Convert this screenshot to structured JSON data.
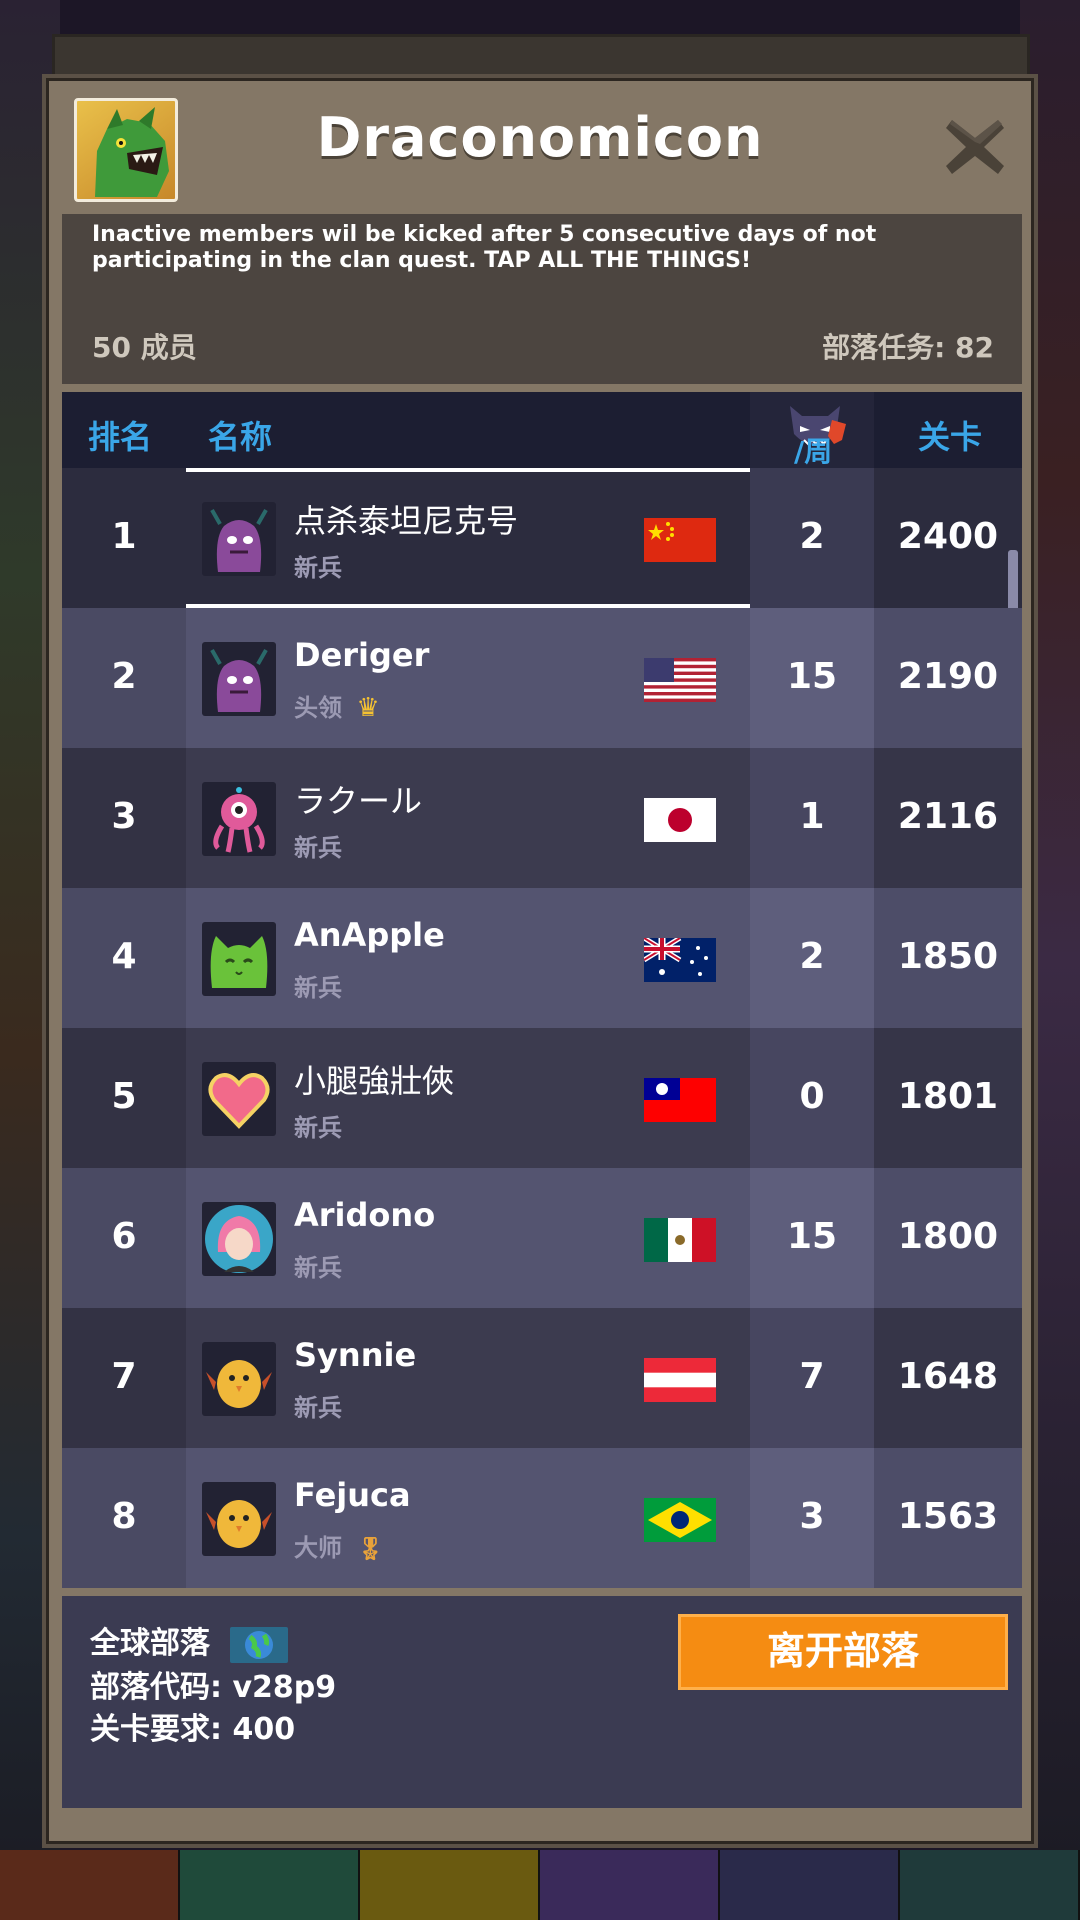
{
  "header": {
    "clan_name": "Draconomicon",
    "description": "Inactive members wil be kicked after 5 consecutive days of not participating in the clan quest. TAP ALL THE THINGS!",
    "member_count": "50 成员",
    "clan_quest": "部落任务: 82"
  },
  "table": {
    "col_rank": "排名",
    "col_name": "名称",
    "col_week": "/周",
    "col_level": "关卡",
    "rows": [
      {
        "rank": "1",
        "name": "点杀泰坦尼克号",
        "role": "新兵",
        "flag": "china-flag",
        "week": "2",
        "level": "2400"
      },
      {
        "rank": "2",
        "name": "Deriger",
        "role": "头领",
        "flag": "usa-flag",
        "week": "15",
        "level": "2190"
      },
      {
        "rank": "3",
        "name": "ラクール",
        "role": "新兵",
        "flag": "japan-flag",
        "week": "1",
        "level": "2116"
      },
      {
        "rank": "4",
        "name": "AnApple",
        "role": "新兵",
        "flag": "australia-flag",
        "week": "2",
        "level": "1850"
      },
      {
        "rank": "5",
        "name": "小腿強壯俠",
        "role": "新兵",
        "flag": "taiwan-flag",
        "week": "0",
        "level": "1801"
      },
      {
        "rank": "6",
        "name": "Aridono",
        "role": "新兵",
        "flag": "mexico-flag",
        "week": "15",
        "level": "1800"
      },
      {
        "rank": "7",
        "name": "Synnie",
        "role": "新兵",
        "flag": "austria-flag",
        "week": "7",
        "level": "1648"
      },
      {
        "rank": "8",
        "name": "Fejuca",
        "role": "大师",
        "flag": "brazil-flag",
        "week": "3",
        "level": "1563"
      }
    ]
  },
  "footer": {
    "clan_type": "全球部落",
    "clan_code": "部落代码: v28p9",
    "level_req": "关卡要求:  400",
    "leave_button": "离开部落"
  },
  "colors": {
    "accent_blue": "#3aa6e8",
    "leave_orange": "#f58c12",
    "panel_brown": "#847766"
  }
}
